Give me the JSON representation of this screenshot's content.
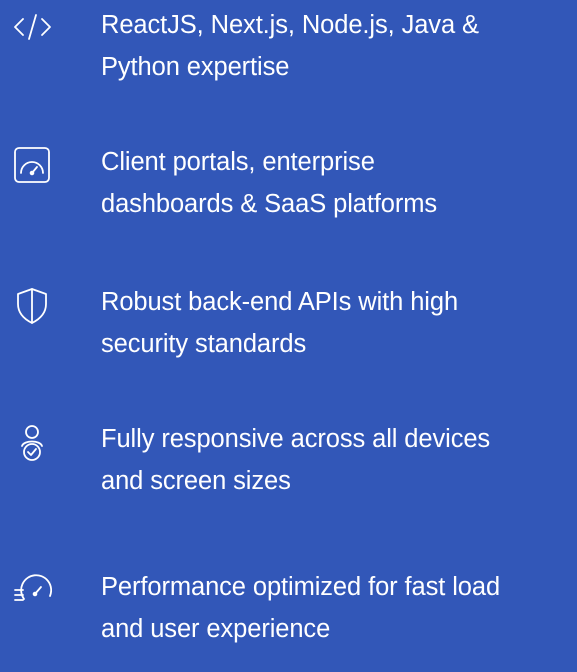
{
  "colors": {
    "background": "#3257b8",
    "text": "#ffffff"
  },
  "features": [
    {
      "icon": "code-icon",
      "lines": [
        "ReactJS, Next.js, Node.js, Java &",
        "Python expertise"
      ]
    },
    {
      "icon": "dashboard-gauge-icon",
      "lines": [
        "Client portals, enterprise",
        "dashboards & SaaS platforms"
      ]
    },
    {
      "icon": "shield-icon",
      "lines": [
        "Robust back-end APIs with high",
        "security standards"
      ]
    },
    {
      "icon": "user-check-icon",
      "lines": [
        "Fully responsive across all devices",
        "and screen sizes"
      ]
    },
    {
      "icon": "speedometer-icon",
      "lines": [
        "Performance optimized for fast load",
        "and user experience"
      ]
    }
  ]
}
